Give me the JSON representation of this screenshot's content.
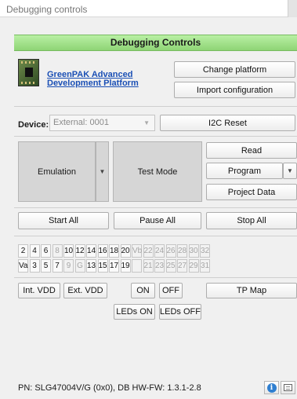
{
  "window": {
    "title": "Debugging controls"
  },
  "header": {
    "title": "Debugging Controls"
  },
  "platform": {
    "link_line1": "GreenPAK Advanced",
    "link_line2": "Development Platform",
    "change_platform": "Change platform",
    "import_configuration": "Import configuration"
  },
  "device": {
    "label": "Device:",
    "value": "External: 0001",
    "i2c_reset": "I2C Reset"
  },
  "modes": {
    "emulation": "Emulation",
    "test_mode": "Test Mode",
    "read": "Read",
    "program": "Program",
    "project_data": "Project Data"
  },
  "run": {
    "start_all": "Start All",
    "pause_all": "Pause All",
    "stop_all": "Stop All"
  },
  "pins": {
    "row1": [
      {
        "label": "2",
        "enabled": true
      },
      {
        "label": "4",
        "enabled": true
      },
      {
        "label": "6",
        "enabled": true
      },
      {
        "label": "8",
        "enabled": false
      },
      {
        "label": "10",
        "enabled": true
      },
      {
        "label": "12",
        "enabled": true
      },
      {
        "label": "14",
        "enabled": true
      },
      {
        "label": "16",
        "enabled": true
      },
      {
        "label": "18",
        "enabled": true
      },
      {
        "label": "20",
        "enabled": true
      },
      {
        "label": "Vb",
        "enabled": false
      },
      {
        "label": "22",
        "enabled": false
      },
      {
        "label": "24",
        "enabled": false
      },
      {
        "label": "26",
        "enabled": false
      },
      {
        "label": "28",
        "enabled": false
      },
      {
        "label": "30",
        "enabled": false
      },
      {
        "label": "32",
        "enabled": false
      }
    ],
    "row2": [
      {
        "label": "Va",
        "enabled": true
      },
      {
        "label": "3",
        "enabled": true
      },
      {
        "label": "5",
        "enabled": true
      },
      {
        "label": "7",
        "enabled": true
      },
      {
        "label": "9",
        "enabled": false
      },
      {
        "label": "G",
        "enabled": false
      },
      {
        "label": "13",
        "enabled": true
      },
      {
        "label": "15",
        "enabled": true
      },
      {
        "label": "17",
        "enabled": true
      },
      {
        "label": "19",
        "enabled": true
      },
      {
        "label": "",
        "enabled": false
      },
      {
        "label": "21",
        "enabled": false
      },
      {
        "label": "23",
        "enabled": false
      },
      {
        "label": "25",
        "enabled": false
      },
      {
        "label": "27",
        "enabled": false
      },
      {
        "label": "29",
        "enabled": false
      },
      {
        "label": "31",
        "enabled": false
      }
    ]
  },
  "power": {
    "int_vdd": "Int. VDD",
    "ext_vdd": "Ext. VDD",
    "on": "ON",
    "off": "OFF",
    "tp_map": "TP Map",
    "leds_on": "LEDs ON",
    "leds_off": "LEDs OFF"
  },
  "footer": {
    "status": "PN: SLG47004V/G (0x0), DB HW-FW: 1.3.1-2.8"
  },
  "icons": {
    "info": "info-icon",
    "log": "log-icon"
  },
  "colors": {
    "header_green": "#9fe08a",
    "link_blue": "#1a4fb5"
  }
}
